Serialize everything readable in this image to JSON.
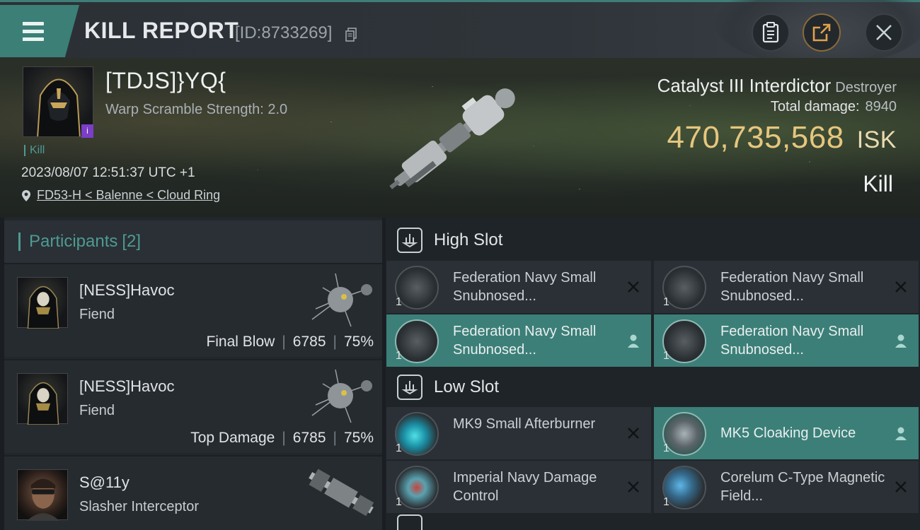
{
  "header": {
    "title": "KILL REPORT",
    "report_id": "[ID:8733269]"
  },
  "victim": {
    "name": "[TDJS]}YQ{",
    "subtitle": "Warp Scramble Strength: 2.0",
    "badge": "i",
    "tag": "Kill",
    "timestamp": "2023/08/07 12:51:37 UTC +1",
    "location": "FD53-H < Balenne < Cloud Ring",
    "ship_name": "Catalyst III Interdictor",
    "ship_class": "Destroyer",
    "total_damage_label": "Total damage:",
    "total_damage_value": "8940",
    "isk_value": "470,735,568",
    "isk_unit": "ISK",
    "result": "Kill"
  },
  "participants": {
    "title": "Participants",
    "count": "[2]",
    "rows": [
      {
        "name": "[NESS]Havoc",
        "ship": "Fiend",
        "role": "Final Blow",
        "damage": "6785",
        "percent": "75%"
      },
      {
        "name": "[NESS]Havoc",
        "ship": "Fiend",
        "role": "Top Damage",
        "damage": "6785",
        "percent": "75%"
      },
      {
        "name": "S@11y",
        "ship": "Slasher Interceptor",
        "role": "",
        "damage": "",
        "percent": ""
      }
    ]
  },
  "slots": {
    "high": {
      "title": "High Slot",
      "modules": [
        {
          "name": "Federation Navy Small Snubnosed...",
          "qty": "1",
          "mark": "destroyed"
        },
        {
          "name": "Federation Navy Small Snubnosed...",
          "qty": "1",
          "mark": "destroyed"
        },
        {
          "name": "Federation Navy Small Snubnosed...",
          "qty": "1",
          "mark": "dropped"
        },
        {
          "name": "Federation Navy Small Snubnosed...",
          "qty": "1",
          "mark": "dropped"
        }
      ]
    },
    "low": {
      "title": "Low Slot",
      "modules": [
        {
          "name": "MK9 Small Afterburner",
          "qty": "1",
          "mark": "destroyed"
        },
        {
          "name": "MK5 Cloaking Device",
          "qty": "1",
          "mark": "dropped"
        },
        {
          "name": "Imperial Navy Damage Control",
          "qty": "1",
          "mark": "destroyed"
        },
        {
          "name": "Corelum C-Type Magnetic Field...",
          "qty": "1",
          "mark": "destroyed"
        }
      ]
    }
  },
  "colors": {
    "accent": "#3c7f78",
    "isk": "#e6c67e",
    "tag": "#4f9a92"
  }
}
